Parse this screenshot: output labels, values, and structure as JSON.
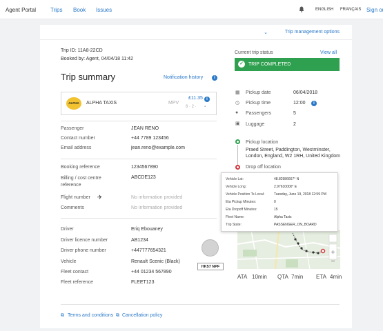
{
  "nav": {
    "brand": "Agent Portal",
    "links": [
      "Trips",
      "Book",
      "Issues"
    ],
    "lang_en": "ENGLISH",
    "lang_fr": "FRANÇAIS",
    "sign_out": "Sign ou"
  },
  "trip_management": {
    "label": "Trip management options"
  },
  "trip": {
    "id_line": "Trip ID: 11A8-22CD",
    "booked_by": "Booked by: Agent, 04/04/18 11:42",
    "summary_title": "Trip summary",
    "notification_history": "Notification history"
  },
  "supplier": {
    "logo_text": "ALPHA",
    "name": "ALPHA TAXIS",
    "vehicle_type": "MPV",
    "price": "£11.35",
    "capacity": "6 · 2 ·"
  },
  "details": [
    {
      "label": "Passenger",
      "value": "JEAN RENO",
      "muted": false
    },
    {
      "label": "Contact number",
      "value": "+44 7789 123456",
      "muted": false
    },
    {
      "label": "Email address",
      "value": "jean.reno@example.com",
      "muted": false
    },
    {
      "label": "Booking reference",
      "value": "1234567890",
      "muted": false
    },
    {
      "label": "Billing / cost centre reference",
      "value": "ABCDE123",
      "muted": false
    },
    {
      "label": "Flight number",
      "value": "No information provided",
      "muted": true
    },
    {
      "label": "Comments",
      "value": "No information provided",
      "muted": true
    },
    {
      "label": "Driver",
      "value": "Eriq Ebouaney",
      "muted": false
    },
    {
      "label": "Driver licence number",
      "value": "AB1234",
      "muted": false
    },
    {
      "label": "Driver phone number",
      "value": "+447777654321",
      "muted": false
    },
    {
      "label": "Vehicle",
      "value": "Renault Scenic (Black)",
      "muted": false
    },
    {
      "label": "Fleet contact",
      "value": "+44 01234 567890",
      "muted": false
    },
    {
      "label": "Fleet reference",
      "value": "FLEET123",
      "muted": false
    }
  ],
  "plate": "HK57 NPF",
  "status": {
    "label": "Current trip status",
    "view_all": "View all",
    "value": "TRIP COMPLETED",
    "color": "#2fa04f"
  },
  "pickup_info": [
    {
      "label": "Pickup date",
      "value": "06/04/2018",
      "icon": "calendar-icon"
    },
    {
      "label": "Pickup time",
      "value": "12:00",
      "icon": "clock-icon"
    },
    {
      "label": "Passengers",
      "value": "5",
      "icon": "person-icon"
    },
    {
      "label": "Luggage",
      "value": "2",
      "icon": "luggage-icon"
    }
  ],
  "route": {
    "pickup_label": "Pickup location",
    "pickup_address": "Praed Street, Paddington, Westminster, London, England, W2 1RH, United Kingdom",
    "dropoff_label": "Drop off location"
  },
  "tooltip": [
    {
      "key": "Vehicle Lat:",
      "value": "48.82986667° N"
    },
    {
      "key": "Vehicle Long:",
      "value": "2.97610000° E"
    },
    {
      "key": "Vehicle Position Ts Local:",
      "value": "Tuesday, June 19, 2018 12:59 PM"
    },
    {
      "key": "Eta Pickup Minutes:",
      "value": "0"
    },
    {
      "key": "Eta Dropoff Minutes:",
      "value": "15"
    },
    {
      "key": "Fleet Name:",
      "value": "Alpha Taxis"
    },
    {
      "key": "Trip State:",
      "value": "PASSENGER_ON_BOARD"
    }
  ],
  "eta": {
    "ata_label": "ATA",
    "ata_value": "10min",
    "qta_label": "QTA",
    "qta_value": "7min",
    "eta_label": "ETA",
    "eta_value": "4min"
  },
  "footer": {
    "terms": "Terms and conditions",
    "cancellation": "Cancellation policy"
  }
}
